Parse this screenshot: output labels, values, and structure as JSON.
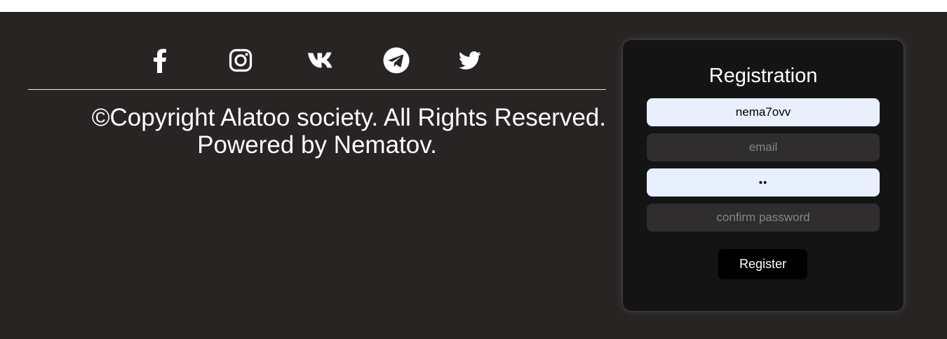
{
  "footer": {
    "social": [
      {
        "name": "facebook-icon"
      },
      {
        "name": "instagram-icon"
      },
      {
        "name": "vk-icon"
      },
      {
        "name": "telegram-icon"
      },
      {
        "name": "twitter-icon"
      }
    ],
    "copyright_line1": "©Copyright Alatoo society. All Rights Reserved.",
    "copyright_line2": "Powered by Nematov."
  },
  "registration": {
    "title": "Registration",
    "username_value": "nema7ovv",
    "email_placeholder": "email",
    "password_value": "••",
    "confirm_placeholder": "confirm password",
    "button_label": "Register"
  },
  "colors": {
    "footer_bg": "#282424",
    "card_bg": "#141414",
    "autofill_bg": "#e8f0fe",
    "empty_field_bg": "#2f2d2e",
    "button_bg": "#000000"
  }
}
